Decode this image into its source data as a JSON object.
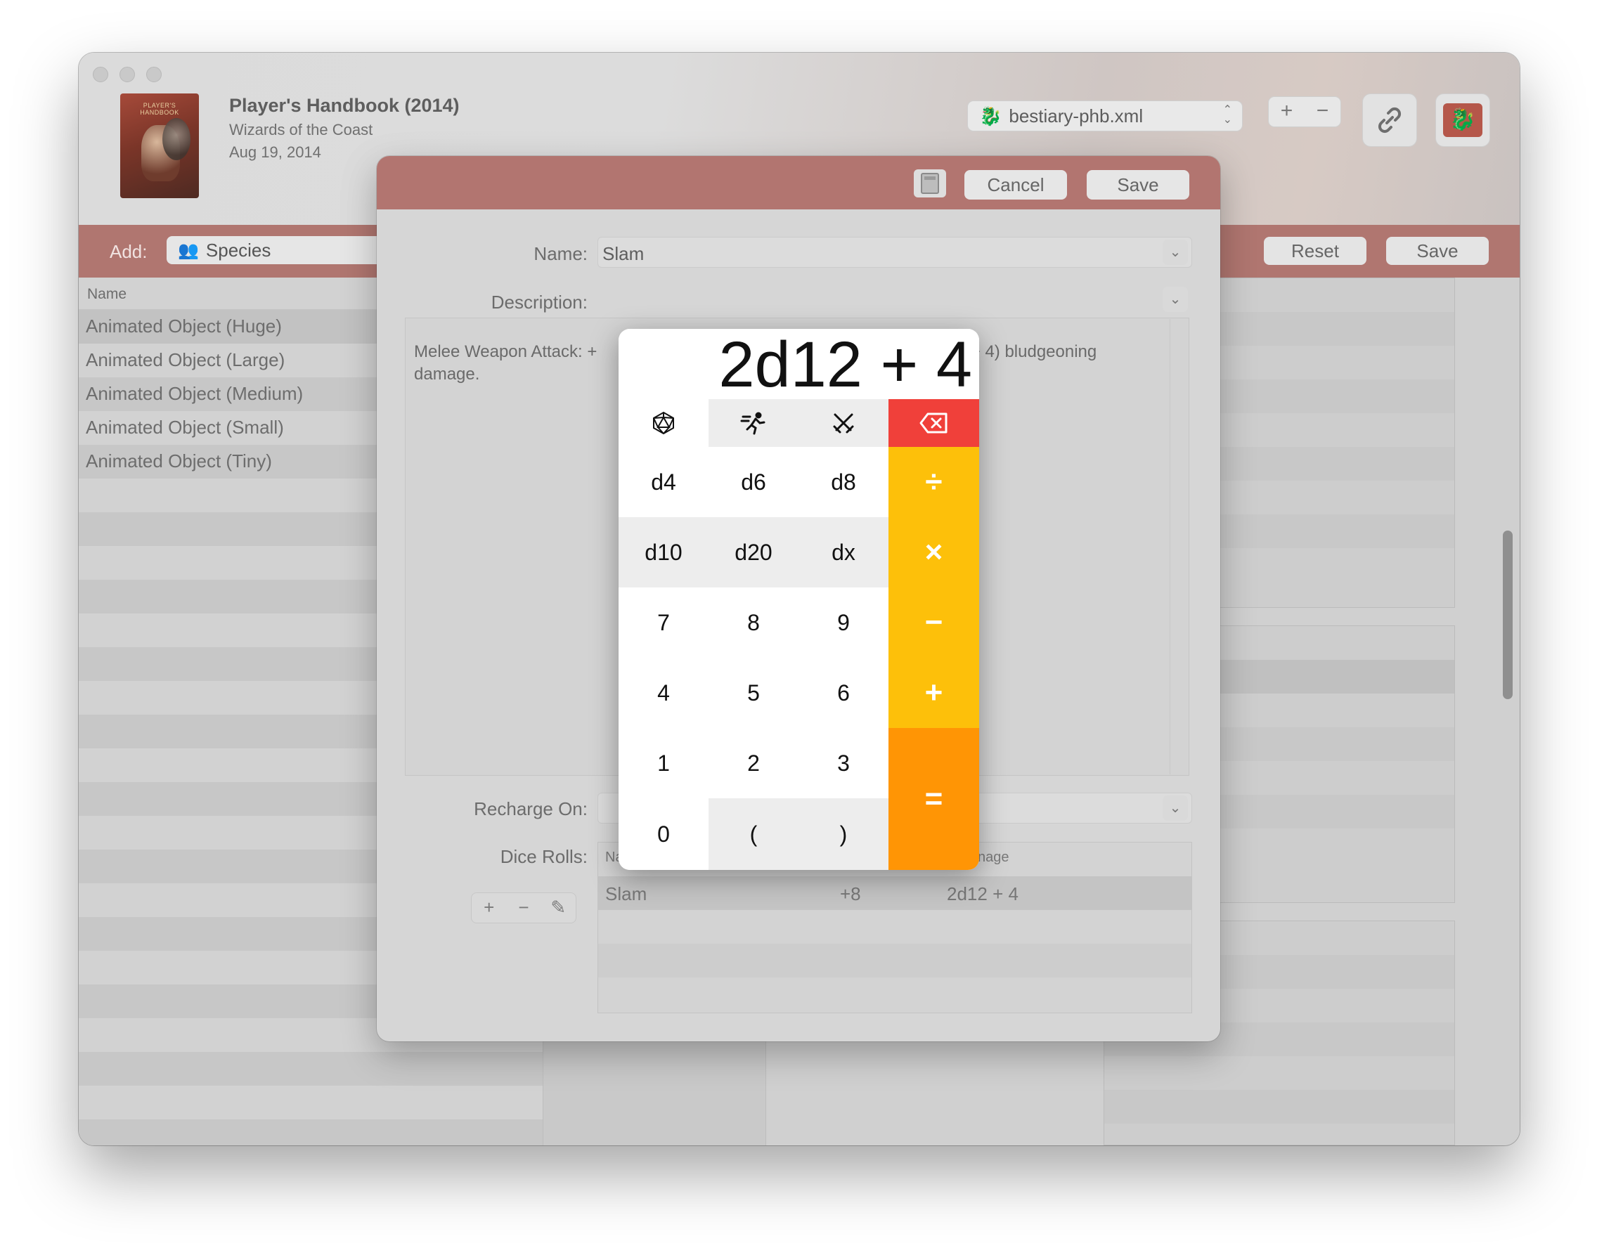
{
  "book": {
    "cover_text": "PLAYER'S HANDBOOK",
    "title": "Player's Handbook (2014)",
    "publisher": "Wizards of the Coast",
    "date": "Aug 19, 2014"
  },
  "toolbar": {
    "source_file": "bestiary-phb.xml",
    "plus": "+",
    "minus": "−"
  },
  "addbar": {
    "add_label": "Add:",
    "category": "Species",
    "reset_label": "Reset",
    "save_label": "Save"
  },
  "list": {
    "header": "Name",
    "items": [
      "Animated Object (Huge)",
      "Animated Object (Large)",
      "Animated Object (Medium)",
      "Animated Object (Small)",
      "Animated Object (Tiny)"
    ]
  },
  "sheet": {
    "cancel_label": "Cancel",
    "save_label": "Save",
    "name_label": "Name:",
    "name_value": "Slam",
    "description_label": "Description:",
    "description_left": "Melee Weapon Attack: +",
    "description_right": "12 + 4) bludgeoning",
    "description_line2": "damage.",
    "recharge_label": "Recharge On:",
    "dice_rolls_label": "Dice Rolls:",
    "dice_table": {
      "col_name_partial": "Na",
      "col_damage_partial": "nage",
      "rows": [
        {
          "name": "Slam",
          "attack": "+8",
          "damage": "2d12 + 4"
        }
      ]
    },
    "mini_buttons": [
      "+",
      "−",
      "✎"
    ]
  },
  "calculator": {
    "display": "2d12 + 4",
    "keys": {
      "dice_mode": "⬡",
      "attack_mode": "🏃",
      "damage_mode": "⚔",
      "backspace": "⌫",
      "d4": "d4",
      "d6": "d6",
      "d8": "d8",
      "d10": "d10",
      "d20": "d20",
      "dx": "dx",
      "divide": "÷",
      "multiply": "×",
      "subtract": "−",
      "add": "+",
      "equals": "=",
      "n7": "7",
      "n8": "8",
      "n9": "9",
      "n4": "4",
      "n5": "5",
      "n6": "6",
      "n1": "1",
      "n2": "2",
      "n3": "3",
      "n0": "0",
      "lparen": "(",
      "rparen": ")"
    }
  },
  "colors": {
    "accent_bar": "#b07670",
    "calc_red": "#f0403a",
    "calc_yellow": "#fdc00a",
    "calc_orange": "#ff9505"
  }
}
